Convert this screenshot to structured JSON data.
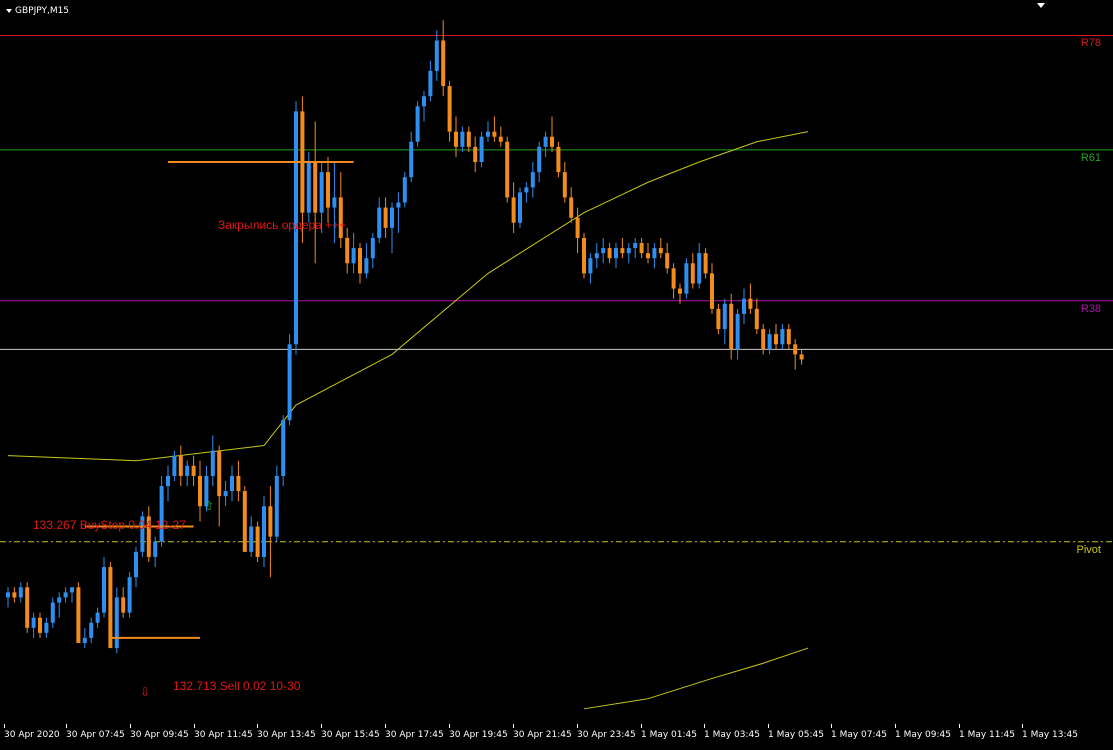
{
  "window": {
    "symbol_title": "GBPJPY,M15"
  },
  "levels": [
    {
      "label": "R78",
      "color": "#d61a1a",
      "price": 137.55
    },
    {
      "label": "R61",
      "color": "#1fa51f",
      "price": 136.42
    },
    {
      "label": "R38",
      "color": "#b012b0",
      "price": 134.93
    },
    {
      "label": "",
      "color": "#c9c9c9",
      "price": 134.45
    },
    {
      "label": "Pivot",
      "color": "#c8c812",
      "price": 132.55
    }
  ],
  "annotations": {
    "closed_orders": "Закрылись ордера +++",
    "buystop": "133.267 BuyStop 0.04 12-27",
    "sell": "132.713 Sell 0.02 10-30",
    "buy_arrow": "⇧",
    "sell_arrow": "⇩"
  },
  "colors": {
    "bull": "#2f8ff0",
    "bear": "#f28c1c",
    "ma": "#c8c816",
    "background": "#000000",
    "axis_text": "#ffffff"
  },
  "time_axis": [
    "30 Apr 2020",
    "30 Apr 07:45",
    "30 Apr 09:45",
    "30 Apr 11:45",
    "30 Apr 13:45",
    "30 Apr 15:45",
    "30 Apr 17:45",
    "30 Apr 19:45",
    "30 Apr 21:45",
    "30 Apr 23:45",
    "1 May 01:45",
    "1 May 03:45",
    "1 May 05:45",
    "1 May 07:45",
    "1 May 09:45",
    "1 May 11:45",
    "1 May 13:45"
  ],
  "chart_data": {
    "type": "candlestick",
    "symbol": "GBPJPY",
    "timeframe": "M15",
    "candles": [
      [
        132.0,
        132.1,
        131.9,
        132.05
      ],
      [
        132.05,
        132.1,
        131.95,
        132.0
      ],
      [
        132.0,
        132.15,
        131.95,
        132.1
      ],
      [
        132.1,
        132.15,
        131.65,
        131.7
      ],
      [
        131.7,
        131.85,
        131.6,
        131.8
      ],
      [
        131.8,
        131.85,
        131.6,
        131.65
      ],
      [
        131.65,
        131.8,
        131.6,
        131.75
      ],
      [
        131.75,
        132.0,
        131.7,
        131.95
      ],
      [
        131.95,
        132.05,
        131.8,
        132.0
      ],
      [
        132.0,
        132.1,
        131.95,
        132.05
      ],
      [
        132.05,
        132.1,
        131.95,
        132.1
      ],
      [
        132.1,
        132.15,
        131.55,
        131.55
      ],
      [
        131.55,
        131.7,
        131.5,
        131.6
      ],
      [
        131.6,
        131.8,
        131.55,
        131.75
      ],
      [
        131.75,
        131.9,
        131.7,
        131.85
      ],
      [
        131.85,
        132.4,
        131.8,
        132.3
      ],
      [
        132.3,
        132.35,
        131.5,
        131.5
      ],
      [
        131.5,
        132.1,
        131.45,
        132.0
      ],
      [
        132.0,
        132.1,
        131.8,
        131.85
      ],
      [
        131.85,
        132.25,
        131.8,
        132.2
      ],
      [
        132.2,
        132.5,
        132.1,
        132.45
      ],
      [
        132.45,
        132.85,
        132.4,
        132.8
      ],
      [
        132.8,
        132.9,
        132.35,
        132.4
      ],
      [
        132.4,
        132.6,
        132.3,
        132.55
      ],
      [
        132.55,
        133.2,
        132.5,
        133.1
      ],
      [
        133.1,
        133.3,
        132.95,
        133.2
      ],
      [
        133.2,
        133.45,
        133.15,
        133.4
      ],
      [
        133.4,
        133.5,
        133.1,
        133.2
      ],
      [
        133.2,
        133.35,
        133.1,
        133.3
      ],
      [
        133.3,
        133.4,
        133.1,
        133.2
      ],
      [
        133.2,
        133.35,
        132.75,
        132.9
      ],
      [
        132.9,
        133.3,
        132.85,
        133.2
      ],
      [
        133.2,
        133.6,
        133.1,
        133.45
      ],
      [
        133.45,
        133.5,
        132.7,
        133.0
      ],
      [
        133.0,
        133.15,
        132.9,
        133.05
      ],
      [
        133.05,
        133.3,
        132.95,
        133.2
      ],
      [
        133.2,
        133.35,
        132.95,
        133.05
      ],
      [
        133.05,
        133.1,
        132.45,
        132.45
      ],
      [
        132.45,
        132.8,
        132.4,
        132.7
      ],
      [
        132.7,
        132.75,
        132.35,
        132.4
      ],
      [
        132.4,
        133.0,
        132.3,
        132.9
      ],
      [
        132.9,
        133.1,
        132.2,
        132.6
      ],
      [
        132.6,
        133.3,
        132.55,
        133.2
      ],
      [
        133.2,
        133.8,
        133.1,
        133.75
      ],
      [
        133.75,
        134.6,
        133.7,
        134.5
      ],
      [
        134.5,
        136.9,
        134.4,
        136.8
      ],
      [
        136.8,
        136.95,
        135.5,
        135.8
      ],
      [
        135.8,
        136.4,
        135.7,
        136.3
      ],
      [
        136.3,
        136.7,
        135.3,
        135.8
      ],
      [
        135.8,
        136.3,
        135.6,
        136.2
      ],
      [
        136.2,
        136.35,
        135.7,
        135.85
      ],
      [
        135.85,
        136.3,
        135.5,
        135.95
      ],
      [
        135.95,
        136.2,
        135.45,
        135.55
      ],
      [
        135.55,
        135.65,
        135.2,
        135.3
      ],
      [
        135.3,
        135.6,
        135.2,
        135.45
      ],
      [
        135.45,
        135.5,
        135.1,
        135.2
      ],
      [
        135.2,
        135.5,
        135.15,
        135.35
      ],
      [
        135.35,
        135.6,
        135.25,
        135.55
      ],
      [
        135.55,
        135.95,
        135.5,
        135.85
      ],
      [
        135.85,
        135.95,
        135.55,
        135.65
      ],
      [
        135.65,
        135.9,
        135.4,
        135.85
      ],
      [
        135.85,
        136.0,
        135.6,
        135.9
      ],
      [
        135.9,
        136.2,
        135.85,
        136.15
      ],
      [
        136.15,
        136.6,
        136.1,
        136.5
      ],
      [
        136.5,
        136.9,
        136.45,
        136.85
      ],
      [
        136.85,
        137.0,
        136.7,
        136.95
      ],
      [
        136.95,
        137.3,
        136.9,
        137.2
      ],
      [
        137.2,
        137.6,
        137.1,
        137.5
      ],
      [
        137.5,
        137.7,
        136.95,
        137.05
      ],
      [
        137.05,
        137.1,
        136.5,
        136.6
      ],
      [
        136.6,
        136.75,
        136.35,
        136.45
      ],
      [
        136.45,
        136.65,
        136.4,
        136.6
      ],
      [
        136.6,
        136.65,
        136.4,
        136.45
      ],
      [
        136.45,
        136.55,
        136.2,
        136.3
      ],
      [
        136.3,
        136.6,
        136.25,
        136.55
      ],
      [
        136.55,
        136.7,
        136.5,
        136.6
      ],
      [
        136.6,
        136.75,
        136.5,
        136.55
      ],
      [
        136.55,
        136.65,
        136.45,
        136.5
      ],
      [
        136.5,
        136.55,
        135.9,
        135.95
      ],
      [
        135.95,
        136.1,
        135.6,
        135.7
      ],
      [
        135.7,
        136.05,
        135.65,
        136.0
      ],
      [
        136.0,
        136.1,
        135.9,
        136.05
      ],
      [
        136.05,
        136.3,
        135.95,
        136.2
      ],
      [
        136.2,
        136.5,
        136.1,
        136.45
      ],
      [
        136.45,
        136.6,
        136.35,
        136.55
      ],
      [
        136.55,
        136.75,
        136.4,
        136.45
      ],
      [
        136.45,
        136.5,
        136.15,
        136.2
      ],
      [
        136.2,
        136.3,
        135.9,
        135.95
      ],
      [
        135.95,
        136.05,
        135.7,
        135.75
      ],
      [
        135.75,
        135.85,
        135.4,
        135.55
      ],
      [
        135.55,
        135.6,
        135.15,
        135.2
      ],
      [
        135.2,
        135.4,
        135.1,
        135.35
      ],
      [
        135.35,
        135.5,
        135.25,
        135.4
      ],
      [
        135.4,
        135.55,
        135.3,
        135.45
      ],
      [
        135.45,
        135.5,
        135.3,
        135.35
      ],
      [
        135.35,
        135.5,
        135.25,
        135.45
      ],
      [
        135.45,
        135.55,
        135.35,
        135.4
      ],
      [
        135.4,
        135.5,
        135.3,
        135.45
      ],
      [
        135.45,
        135.55,
        135.35,
        135.5
      ],
      [
        135.5,
        135.55,
        135.35,
        135.4
      ],
      [
        135.4,
        135.5,
        135.3,
        135.35
      ],
      [
        135.35,
        135.5,
        135.25,
        135.45
      ],
      [
        135.45,
        135.55,
        135.35,
        135.4
      ],
      [
        135.4,
        135.5,
        135.2,
        135.25
      ],
      [
        135.25,
        135.3,
        134.95,
        135.05
      ],
      [
        135.05,
        135.1,
        134.9,
        135.0
      ],
      [
        135.0,
        135.35,
        134.95,
        135.3
      ],
      [
        135.3,
        135.4,
        135.05,
        135.1
      ],
      [
        135.1,
        135.5,
        135.05,
        135.4
      ],
      [
        135.4,
        135.45,
        135.15,
        135.2
      ],
      [
        135.2,
        135.3,
        134.8,
        134.85
      ],
      [
        134.85,
        134.9,
        134.6,
        134.65
      ],
      [
        134.65,
        134.95,
        134.5,
        134.9
      ],
      [
        134.9,
        135.0,
        134.35,
        134.45
      ],
      [
        134.45,
        134.85,
        134.35,
        134.8
      ],
      [
        134.8,
        135.05,
        134.7,
        134.95
      ],
      [
        134.95,
        135.1,
        134.8,
        134.85
      ],
      [
        134.85,
        134.95,
        134.6,
        134.65
      ],
      [
        134.65,
        134.7,
        134.4,
        134.45
      ],
      [
        134.45,
        134.65,
        134.4,
        134.6
      ],
      [
        134.6,
        134.7,
        134.45,
        134.5
      ],
      [
        134.5,
        134.7,
        134.45,
        134.65
      ],
      [
        134.65,
        134.7,
        134.45,
        134.5
      ],
      [
        134.5,
        134.55,
        134.25,
        134.4
      ],
      [
        134.4,
        134.45,
        134.3,
        134.35
      ]
    ],
    "moving_averages": [
      {
        "points": [
          [
            0,
            133.4
          ],
          [
            20,
            133.35
          ],
          [
            40,
            133.5
          ],
          [
            45,
            133.9
          ],
          [
            60,
            134.4
          ],
          [
            75,
            135.2
          ],
          [
            90,
            135.8
          ],
          [
            100,
            136.1
          ],
          [
            108,
            136.3
          ],
          [
            117,
            136.5
          ],
          [
            125,
            136.6
          ]
        ]
      },
      {
        "points": [
          [
            90,
            130.9
          ],
          [
            100,
            131.0
          ],
          [
            110,
            131.2
          ],
          [
            118,
            131.35
          ],
          [
            125,
            131.5
          ]
        ]
      }
    ],
    "order_lines": [
      {
        "price": 136.3,
        "from": 25,
        "to": 54,
        "color": "#f28c1c"
      },
      {
        "price": 132.7,
        "from": 12,
        "to": 29,
        "color": "#f28c1c"
      },
      {
        "price": 131.6,
        "from": 16,
        "to": 30,
        "color": "#f28c1c"
      }
    ],
    "ylim": [
      130.75,
      137.9
    ],
    "grid": false
  }
}
